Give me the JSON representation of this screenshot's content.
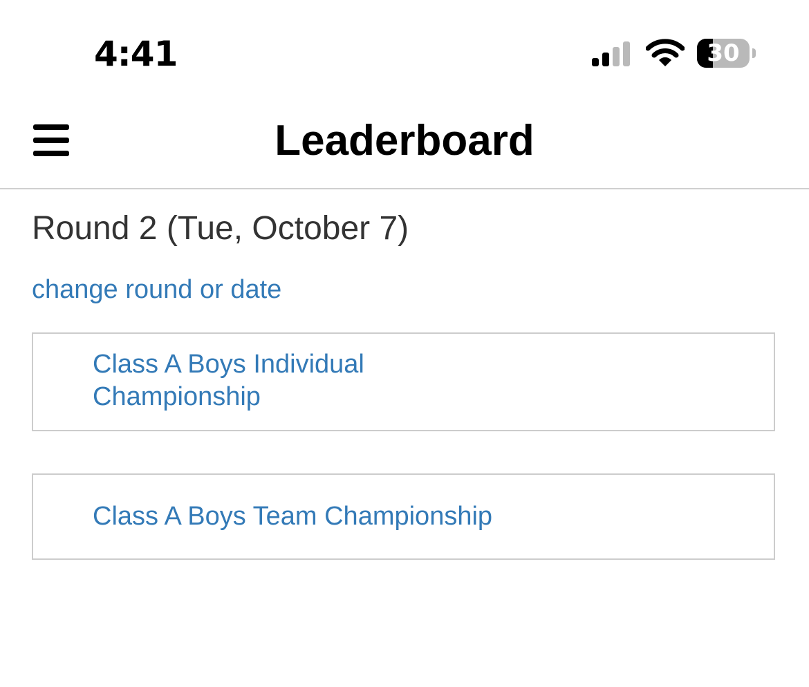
{
  "status_bar": {
    "time": "4:41",
    "battery_level": "30",
    "battery_fraction": 0.3,
    "icons": [
      "cellular-signal-icon",
      "wifi-icon",
      "battery-icon"
    ]
  },
  "nav": {
    "title": "Leaderboard",
    "menu_icon": "hamburger-menu-icon"
  },
  "content": {
    "round_title": "Round 2 (Tue, October 7)",
    "change_link": "change round or date",
    "items": [
      {
        "label": "Class A Boys Individual Championship"
      },
      {
        "label": "Class A Boys Team Championship"
      }
    ]
  },
  "colors": {
    "link": "#337ab7",
    "heading_text": "#333333",
    "card_border": "#cccccc",
    "divider": "#cfcfcf"
  }
}
